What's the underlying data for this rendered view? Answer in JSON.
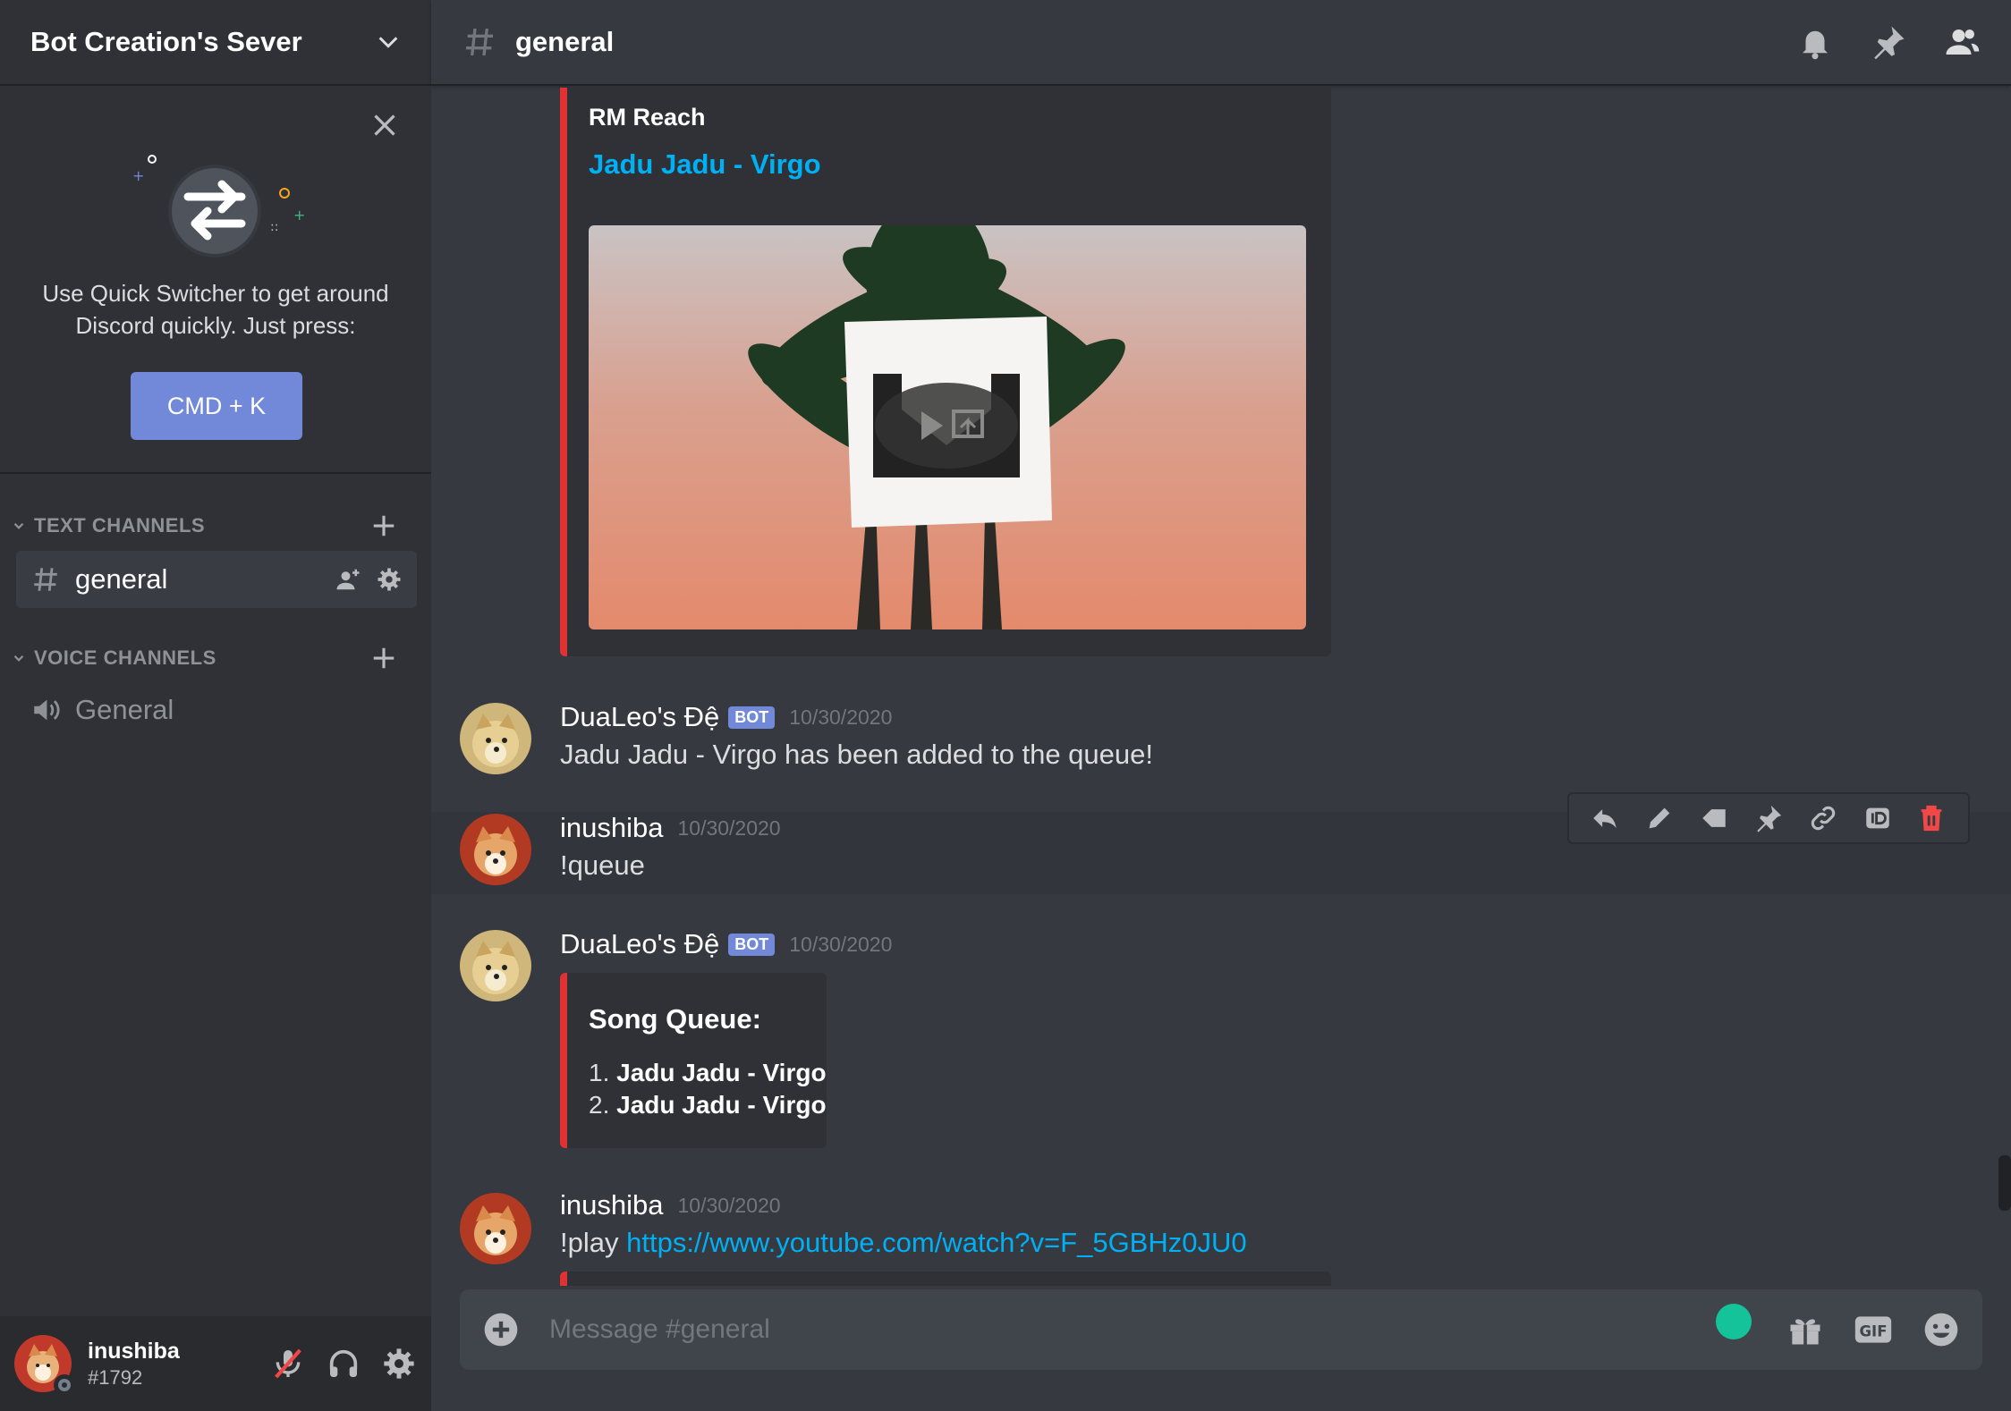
{
  "server": {
    "name": "Bot Creation's Sever"
  },
  "quick_switcher": {
    "text": "Use Quick Switcher to get around Discord quickly. Just press:",
    "shortcut": "CMD + K"
  },
  "categories": {
    "text": "TEXT CHANNELS",
    "voice": "VOICE CHANNELS"
  },
  "channels": {
    "text": [
      {
        "name": "general"
      }
    ],
    "voice": [
      {
        "name": "General"
      }
    ]
  },
  "user": {
    "name": "inushiba",
    "tag": "#1792"
  },
  "topbar": {
    "channel": "general"
  },
  "embed1": {
    "author": "RM Reach",
    "title": "Jadu Jadu - Virgo"
  },
  "messages": [
    {
      "author": "DuaLeo's Đệ",
      "badge": "BOT",
      "time": "10/30/2020",
      "text": "Jadu Jadu - Virgo has been added to the queue!"
    },
    {
      "author": "inushiba",
      "time": "10/30/2020",
      "text": "!queue"
    },
    {
      "author": "DuaLeo's Đệ",
      "badge": "BOT",
      "time": "10/30/2020"
    },
    {
      "author": "inushiba",
      "time": "10/30/2020",
      "text_prefix": "!play ",
      "link": "https://www.youtube.com/watch?v=F_5GBHz0JU0"
    }
  ],
  "queue_embed": {
    "title": "Song Queue:",
    "items": [
      {
        "num": "1.",
        "title": "Jadu Jadu - Virgo"
      },
      {
        "num": "2.",
        "title": "Jadu Jadu - Virgo"
      }
    ]
  },
  "composer": {
    "placeholder": "Message #general"
  },
  "colors": {
    "accent": "#7289da",
    "embed_border": "#e03232",
    "link": "#00b0f4",
    "delete": "#f04747"
  }
}
